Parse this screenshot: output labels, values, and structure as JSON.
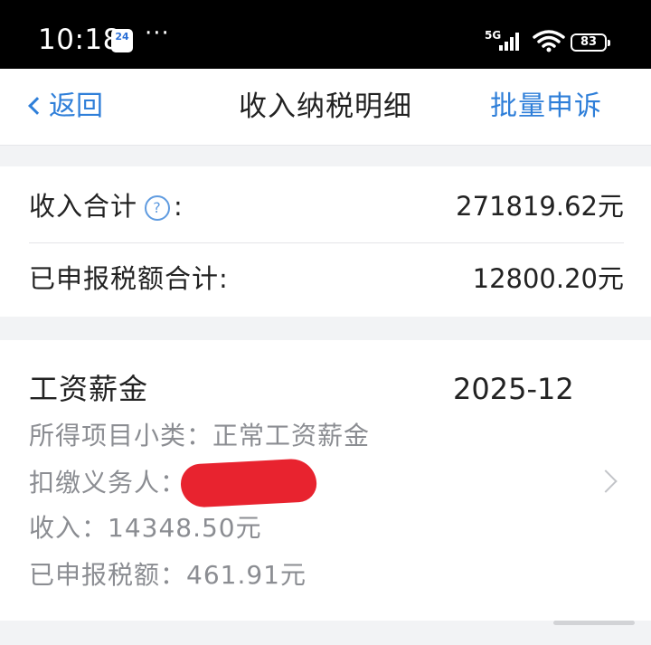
{
  "status_bar": {
    "time": "10:18",
    "calendar_day": "24",
    "more": "···",
    "network": "5G",
    "battery": "83"
  },
  "nav": {
    "back_label": "返回",
    "title": "收入纳税明细",
    "action_label": "批量申诉"
  },
  "summary": {
    "income_total_label": "收入合计",
    "income_total_colon": ":",
    "income_total_value": "271819.62元",
    "tax_total_label": "已申报税额合计:",
    "tax_total_value": "12800.20元"
  },
  "record": {
    "title": "工资薪金",
    "period": "2025-12",
    "category_line": "所得项目小类：正常工资薪金",
    "withholder_label": "扣缴义务人：",
    "income_line": "收入：14348.50元",
    "tax_line": "已申报税额：461.91元"
  },
  "colors": {
    "accent": "#2f7fd9",
    "redaction": "#e8232f"
  }
}
